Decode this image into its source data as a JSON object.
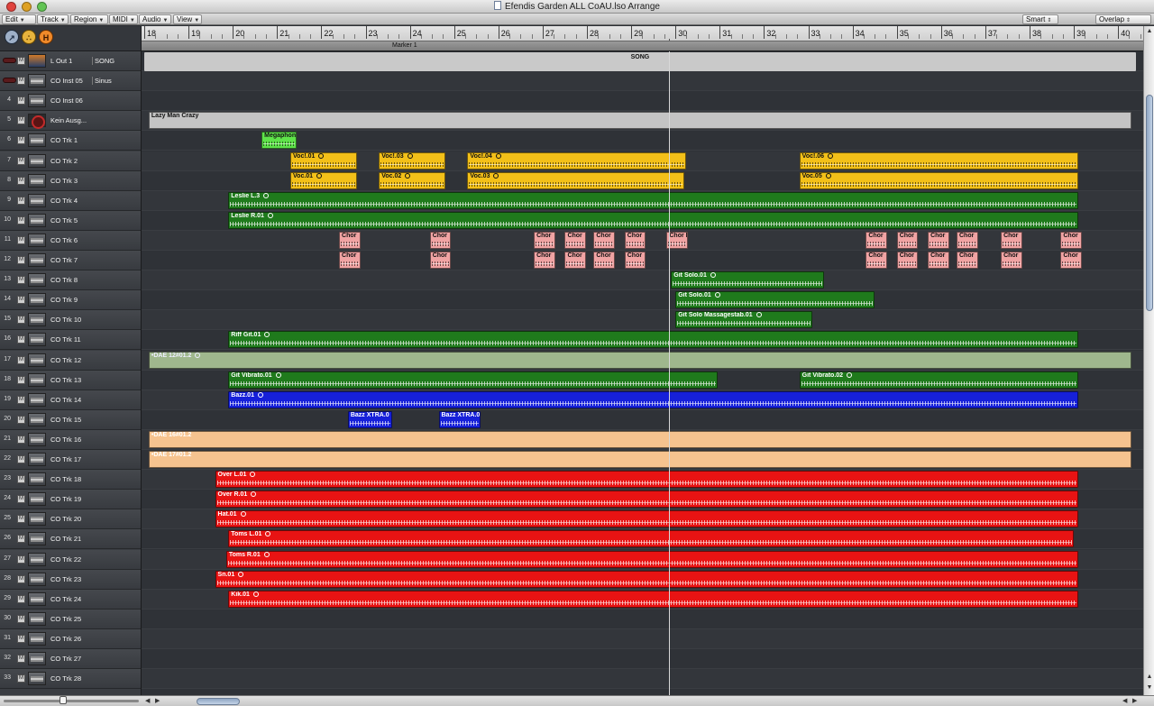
{
  "window": {
    "title": "Efendis Garden ALL CoAU.lso Arrange",
    "traffic_colors": [
      "#e0443e",
      "#dea123",
      "#62c454"
    ]
  },
  "menu": {
    "items": [
      {
        "id": "edit",
        "label": "Edit"
      },
      {
        "id": "track",
        "label": "Track"
      },
      {
        "id": "region",
        "label": "Region"
      },
      {
        "id": "midi",
        "label": "MIDI"
      },
      {
        "id": "audio",
        "label": "Audio"
      },
      {
        "id": "view",
        "label": "View"
      }
    ],
    "tool_select": "Smart",
    "drag_mode": "Overlap"
  },
  "tool_icons": [
    {
      "name": "catch-icon",
      "glyph": "↗"
    },
    {
      "name": "link-icon",
      "glyph": "∴"
    },
    {
      "name": "hide-icon",
      "glyph": "H"
    }
  ],
  "ruler": {
    "first_bar": 18,
    "last_bar": 40,
    "marker": "Marker 1"
  },
  "colors": {
    "green": "#1f7a1c",
    "yellow": "#f3c019",
    "pink": "#f0a3a3",
    "blue": "#1620d9",
    "red": "#e81313",
    "grey": "#c4c4c4",
    "sage": "#9fb78d",
    "peach": "#f6c38f",
    "lime": "#5fe34a"
  },
  "tracks": [
    {
      "num": "1",
      "name": "L Out 1",
      "sub": "SONG",
      "thumb": "out"
    },
    {
      "num": "3",
      "name": "CO Inst 05",
      "sub": "Sinus",
      "thumb": "wave"
    },
    {
      "num": "4",
      "name": "CO Inst 06",
      "sub": "",
      "thumb": "wave"
    },
    {
      "num": "5",
      "name": "Kein Ausg...",
      "sub": "",
      "thumb": "none"
    },
    {
      "num": "6",
      "name": "CO Trk 1",
      "sub": "",
      "thumb": "wave"
    },
    {
      "num": "7",
      "name": "CO Trk 2",
      "sub": "",
      "thumb": "wave"
    },
    {
      "num": "8",
      "name": "CO Trk 3",
      "sub": "",
      "thumb": "wave"
    },
    {
      "num": "9",
      "name": "CO Trk 4",
      "sub": "",
      "thumb": "wave"
    },
    {
      "num": "10",
      "name": "CO Trk 5",
      "sub": "",
      "thumb": "wave"
    },
    {
      "num": "11",
      "name": "CO Trk 6",
      "sub": "",
      "thumb": "wave"
    },
    {
      "num": "12",
      "name": "CO Trk 7",
      "sub": "",
      "thumb": "wave"
    },
    {
      "num": "13",
      "name": "CO Trk 8",
      "sub": "",
      "thumb": "wave"
    },
    {
      "num": "14",
      "name": "CO Trk 9",
      "sub": "",
      "thumb": "wave"
    },
    {
      "num": "15",
      "name": "CO Trk 10",
      "sub": "",
      "thumb": "wave"
    },
    {
      "num": "16",
      "name": "CO Trk 11",
      "sub": "",
      "thumb": "wave"
    },
    {
      "num": "17",
      "name": "CO Trk 12",
      "sub": "",
      "thumb": "wave"
    },
    {
      "num": "18",
      "name": "CO Trk 13",
      "sub": "",
      "thumb": "wave"
    },
    {
      "num": "19",
      "name": "CO Trk 14",
      "sub": "",
      "thumb": "wave"
    },
    {
      "num": "20",
      "name": "CO Trk 15",
      "sub": "",
      "thumb": "wave"
    },
    {
      "num": "21",
      "name": "CO Trk 16",
      "sub": "",
      "thumb": "wave"
    },
    {
      "num": "22",
      "name": "CO Trk 17",
      "sub": "",
      "thumb": "wave"
    },
    {
      "num": "23",
      "name": "CO Trk 18",
      "sub": "",
      "thumb": "wave"
    },
    {
      "num": "24",
      "name": "CO Trk 19",
      "sub": "",
      "thumb": "wave"
    },
    {
      "num": "25",
      "name": "CO Trk 20",
      "sub": "",
      "thumb": "wave"
    },
    {
      "num": "26",
      "name": "CO Trk 21",
      "sub": "",
      "thumb": "wave"
    },
    {
      "num": "27",
      "name": "CO Trk 22",
      "sub": "",
      "thumb": "wave"
    },
    {
      "num": "28",
      "name": "CO Trk 23",
      "sub": "",
      "thumb": "wave"
    },
    {
      "num": "29",
      "name": "CO Trk 24",
      "sub": "",
      "thumb": "wave"
    },
    {
      "num": "30",
      "name": "CO Trk 25",
      "sub": "",
      "thumb": "wave"
    },
    {
      "num": "31",
      "name": "CO Trk 26",
      "sub": "",
      "thumb": "wave"
    },
    {
      "num": "32",
      "name": "CO Trk 27",
      "sub": "",
      "thumb": "wave"
    },
    {
      "num": "33",
      "name": "CO Trk 28",
      "sub": "",
      "thumb": "wave"
    }
  ],
  "regions": [
    {
      "row": 0,
      "start": 18,
      "end": 40.4,
      "name": "SONG",
      "color": "song",
      "wave": false
    },
    {
      "row": 3,
      "start": 18.1,
      "end": 40.3,
      "name": "Lazy Man Crazy",
      "color": "grey",
      "wave": false
    },
    {
      "row": 4,
      "start": 20.65,
      "end": 21.45,
      "name": "Megaphon",
      "color": "lime",
      "wave": true
    },
    {
      "row": 5,
      "start": 21.3,
      "end": 22.8,
      "name": "Voc!.01",
      "color": "yellow",
      "wave": true,
      "loop": true
    },
    {
      "row": 5,
      "start": 23.3,
      "end": 24.8,
      "name": "Voc!.03",
      "color": "yellow",
      "wave": true,
      "loop": true
    },
    {
      "row": 5,
      "start": 25.3,
      "end": 30.25,
      "name": "Voc!.04",
      "color": "yellow",
      "wave": true,
      "loop": true
    },
    {
      "row": 5,
      "start": 32.8,
      "end": 39.1,
      "name": "Voc!.06",
      "color": "yellow",
      "wave": true,
      "loop": true
    },
    {
      "row": 6,
      "start": 21.3,
      "end": 22.8,
      "name": "Voc.01",
      "color": "yellow",
      "wave": true,
      "loop": true
    },
    {
      "row": 6,
      "start": 23.3,
      "end": 24.8,
      "name": "Voc.02",
      "color": "yellow",
      "wave": true,
      "loop": true
    },
    {
      "row": 6,
      "start": 25.3,
      "end": 30.2,
      "name": "Voc.03",
      "color": "yellow",
      "wave": true,
      "loop": true
    },
    {
      "row": 6,
      "start": 32.8,
      "end": 39.1,
      "name": "Voc.05",
      "color": "yellow",
      "wave": true,
      "loop": true
    },
    {
      "row": 7,
      "start": 19.9,
      "end": 39.1,
      "name": "Leslie L.3",
      "color": "green",
      "wave": true,
      "loop": true
    },
    {
      "row": 8,
      "start": 19.9,
      "end": 39.1,
      "name": "Leslie R.01",
      "color": "green",
      "wave": true,
      "loop": true
    },
    {
      "row": 9,
      "start": 22.4,
      "end": 22.88,
      "name": "Chor",
      "color": "pink",
      "wave": true
    },
    {
      "row": 9,
      "start": 24.45,
      "end": 24.93,
      "name": "Chor",
      "color": "pink",
      "wave": true
    },
    {
      "row": 9,
      "start": 26.8,
      "end": 27.28,
      "name": "Chor",
      "color": "pink",
      "wave": true
    },
    {
      "row": 9,
      "start": 27.5,
      "end": 27.98,
      "name": "Chor",
      "color": "pink",
      "wave": true
    },
    {
      "row": 9,
      "start": 28.15,
      "end": 28.63,
      "name": "Chor",
      "color": "pink",
      "wave": true
    },
    {
      "row": 9,
      "start": 28.85,
      "end": 29.33,
      "name": "Chor",
      "color": "pink",
      "wave": true
    },
    {
      "row": 9,
      "start": 29.8,
      "end": 30.28,
      "name": "Chor L",
      "color": "pink",
      "wave": true
    },
    {
      "row": 9,
      "start": 34.3,
      "end": 34.78,
      "name": "Chor",
      "color": "pink",
      "wave": true
    },
    {
      "row": 9,
      "start": 35,
      "end": 35.48,
      "name": "Chor",
      "color": "pink",
      "wave": true
    },
    {
      "row": 9,
      "start": 35.7,
      "end": 36.18,
      "name": "Chor",
      "color": "pink",
      "wave": true
    },
    {
      "row": 9,
      "start": 36.35,
      "end": 36.83,
      "name": "Chor",
      "color": "pink",
      "wave": true
    },
    {
      "row": 9,
      "start": 37.35,
      "end": 37.83,
      "name": "Chor",
      "color": "pink",
      "wave": true
    },
    {
      "row": 9,
      "start": 38.7,
      "end": 39.18,
      "name": "Chor",
      "color": "pink",
      "wave": true
    },
    {
      "row": 10,
      "start": 22.4,
      "end": 22.88,
      "name": "Chor",
      "color": "pink",
      "wave": true
    },
    {
      "row": 10,
      "start": 24.45,
      "end": 24.93,
      "name": "Chor",
      "color": "pink",
      "wave": true
    },
    {
      "row": 10,
      "start": 26.8,
      "end": 27.28,
      "name": "Chor",
      "color": "pink",
      "wave": true
    },
    {
      "row": 10,
      "start": 27.5,
      "end": 27.98,
      "name": "Chor",
      "color": "pink",
      "wave": true
    },
    {
      "row": 10,
      "start": 28.15,
      "end": 28.63,
      "name": "Chor",
      "color": "pink",
      "wave": true
    },
    {
      "row": 10,
      "start": 28.85,
      "end": 29.33,
      "name": "Chor",
      "color": "pink",
      "wave": true
    },
    {
      "row": 10,
      "start": 34.3,
      "end": 34.78,
      "name": "Chor",
      "color": "pink",
      "wave": true
    },
    {
      "row": 10,
      "start": 35,
      "end": 35.48,
      "name": "Chor",
      "color": "pink",
      "wave": true
    },
    {
      "row": 10,
      "start": 35.7,
      "end": 36.18,
      "name": "Chor",
      "color": "pink",
      "wave": true
    },
    {
      "row": 10,
      "start": 36.35,
      "end": 36.83,
      "name": "Chor",
      "color": "pink",
      "wave": true
    },
    {
      "row": 10,
      "start": 37.35,
      "end": 37.83,
      "name": "Chor",
      "color": "pink",
      "wave": true
    },
    {
      "row": 10,
      "start": 38.7,
      "end": 39.18,
      "name": "Chor",
      "color": "pink",
      "wave": true
    },
    {
      "row": 11,
      "start": 29.9,
      "end": 33.35,
      "name": "Git Solo.01",
      "color": "green",
      "wave": true,
      "loop": true
    },
    {
      "row": 12,
      "start": 30.0,
      "end": 34.5,
      "name": "Git Solo.01",
      "color": "green",
      "wave": true,
      "loop": true
    },
    {
      "row": 13,
      "start": 30.0,
      "end": 33.1,
      "name": "Git Solo Massagestab.01",
      "color": "green",
      "wave": true,
      "loop": true
    },
    {
      "row": 14,
      "start": 19.9,
      "end": 39.1,
      "name": "Riff Git.01",
      "color": "green",
      "wave": true,
      "loop": true
    },
    {
      "row": 15,
      "start": 18.1,
      "end": 40.3,
      "name": "•DAE 12#01.2",
      "color": "sage",
      "wave": false,
      "loop": true
    },
    {
      "row": 16,
      "start": 19.9,
      "end": 30.95,
      "name": "Git Vibrato.01",
      "color": "green",
      "wave": true,
      "loop": true
    },
    {
      "row": 16,
      "start": 32.8,
      "end": 39.1,
      "name": "Git Vibrato.02",
      "color": "green",
      "wave": true,
      "loop": true
    },
    {
      "row": 17,
      "start": 19.9,
      "end": 39.1,
      "name": "Bazz.01",
      "color": "blue",
      "wave": true,
      "loop": true
    },
    {
      "row": 18,
      "start": 22.6,
      "end": 23.6,
      "name": "Bazz XTRA.0",
      "color": "blue",
      "wave": true
    },
    {
      "row": 18,
      "start": 24.65,
      "end": 25.6,
      "name": "Bazz XTRA.0",
      "color": "blue",
      "wave": true
    },
    {
      "row": 19,
      "start": 18.1,
      "end": 40.3,
      "name": "•DAE 16#01.2",
      "color": "peach",
      "wave": false
    },
    {
      "row": 20,
      "start": 18.1,
      "end": 40.3,
      "name": "•DAE 17#01.2",
      "color": "peach",
      "wave": false
    },
    {
      "row": 21,
      "start": 19.6,
      "end": 39.1,
      "name": "Over L.01",
      "color": "red",
      "wave": true,
      "loop": true
    },
    {
      "row": 22,
      "start": 19.6,
      "end": 39.1,
      "name": "Over R.01",
      "color": "red",
      "wave": true,
      "loop": true
    },
    {
      "row": 23,
      "start": 19.6,
      "end": 39.1,
      "name": "Hat.01",
      "color": "red",
      "wave": true,
      "loop": true
    },
    {
      "row": 24,
      "start": 19.9,
      "end": 39.0,
      "name": "Toms L.01",
      "color": "red",
      "wave": true,
      "loop": true
    },
    {
      "row": 25,
      "start": 19.85,
      "end": 39.1,
      "name": "Toms R.01",
      "color": "red",
      "wave": true,
      "loop": true
    },
    {
      "row": 26,
      "start": 19.6,
      "end": 39.1,
      "name": "Sn.01",
      "color": "red",
      "wave": true,
      "loop": true
    },
    {
      "row": 27,
      "start": 19.9,
      "end": 39.1,
      "name": "Kik.01",
      "color": "red",
      "wave": true,
      "loop": true
    }
  ],
  "playhead_bar": 29.85
}
